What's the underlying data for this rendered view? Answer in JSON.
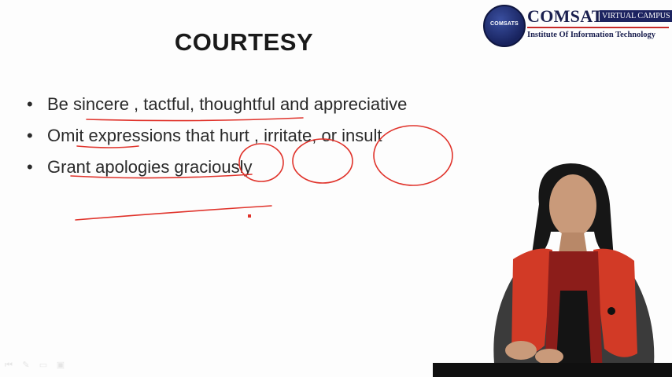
{
  "logo": {
    "seal_text": "COMSATS",
    "name": "COMSATS",
    "badge": "VIRTUAL CAMPUS",
    "subtitle": "Institute Of Information Technology"
  },
  "slide": {
    "title": "COURTESY",
    "bullets": [
      {
        "marker": "•",
        "text": "Be sincere , tactful, thoughtful and appreciative"
      },
      {
        "marker": "•",
        "text": "Omit expressions that hurt , irritate, or insult"
      },
      {
        "marker": "•",
        "text": "Grant apologies graciously"
      }
    ]
  },
  "annotation_color": "#e0332b",
  "player": {
    "controls": [
      {
        "icon": "skip-back-icon"
      },
      {
        "icon": "pen-icon"
      },
      {
        "icon": "eraser-icon"
      },
      {
        "icon": "screen-icon"
      }
    ]
  }
}
